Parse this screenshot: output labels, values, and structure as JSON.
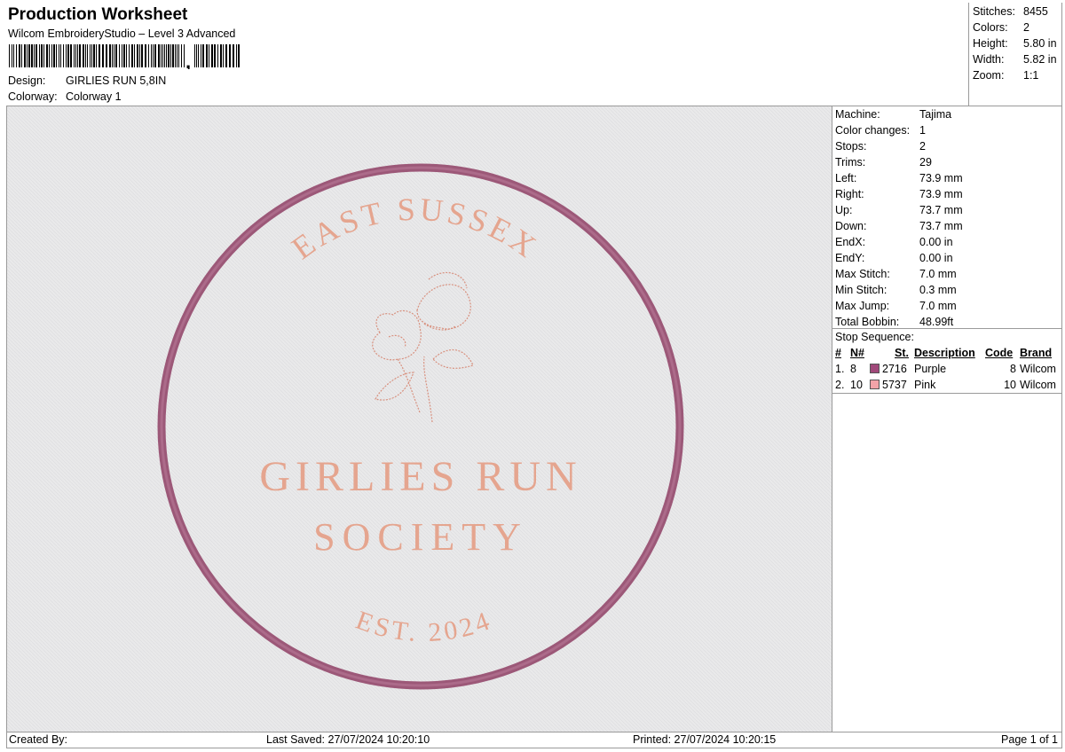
{
  "header": {
    "title": "Production Worksheet",
    "subtitle": "Wilcom EmbroideryStudio – Level 3 Advanced",
    "design_label": "Design:",
    "design_value": "GIRLIES RUN 5,8IN",
    "colorway_label": "Colorway:",
    "colorway_value": "Colorway 1"
  },
  "stats": [
    {
      "label": "Stitches:",
      "value": "8455"
    },
    {
      "label": "Colors:",
      "value": "2"
    },
    {
      "label": "Height:",
      "value": "5.80 in"
    },
    {
      "label": "Width:",
      "value": "5.82 in"
    },
    {
      "label": "Zoom:",
      "value": "1:1"
    }
  ],
  "machine_info": [
    {
      "label": "Machine:",
      "value": "Tajima"
    },
    {
      "label": "Color changes:",
      "value": "1"
    },
    {
      "label": "Stops:",
      "value": "2"
    },
    {
      "label": "Trims:",
      "value": "29"
    },
    {
      "label": "Left:",
      "value": "73.9 mm"
    },
    {
      "label": "Right:",
      "value": "73.9 mm"
    },
    {
      "label": "Up:",
      "value": "73.7 mm"
    },
    {
      "label": "Down:",
      "value": "73.7 mm"
    },
    {
      "label": "EndX:",
      "value": "0.00 in"
    },
    {
      "label": "EndY:",
      "value": "0.00 in"
    },
    {
      "label": "Max Stitch:",
      "value": "7.0 mm"
    },
    {
      "label": "Min Stitch:",
      "value": "0.3 mm"
    },
    {
      "label": "Max Jump:",
      "value": "7.0 mm"
    },
    {
      "label": "Total Bobbin:",
      "value": "48.99ft"
    }
  ],
  "stop_sequence": {
    "title": "Stop Sequence:",
    "headers": {
      "num": "#",
      "n": "N#",
      "st": "St.",
      "description": "Description",
      "code": "Code",
      "brand": "Brand"
    },
    "rows": [
      {
        "num": "1.",
        "n": "8",
        "color": "#a0497a",
        "st": "2716",
        "description": "Purple",
        "code": "8",
        "brand": "Wilcom"
      },
      {
        "num": "2.",
        "n": "10",
        "color": "#f2a3a8",
        "st": "5737",
        "description": "Pink",
        "code": "10",
        "brand": "Wilcom"
      }
    ]
  },
  "design": {
    "top_text": "EAST SUSSEX",
    "line1": "GIRLIES RUN",
    "line2": "SOCIETY",
    "bottom_text": "EST. 2024",
    "ring_color": "#9c5878",
    "text_color": "#e5a58f"
  },
  "footer": {
    "created_by": "Created By:",
    "last_saved": "Last Saved: 27/07/2024 10:20:10",
    "printed": "Printed: 27/07/2024 10:20:15",
    "page": "Page 1 of 1"
  }
}
